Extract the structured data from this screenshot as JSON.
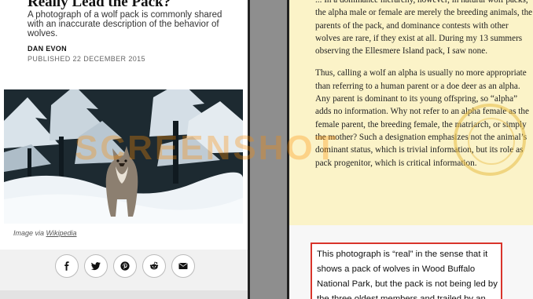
{
  "left_article": {
    "headline_tail": "Really Lead the Pack?",
    "summary": "A photograph of a wolf pack is commonly shared with an inaccurate description of the behavior of wolves.",
    "author": "DAN EVON",
    "published": "PUBLISHED 22 DECEMBER 2015",
    "caption_prefix": "Image via",
    "caption_link": "Wikipedia",
    "share_icons": [
      "facebook-icon",
      "twitter-icon",
      "pinterest-icon",
      "reddit-icon",
      "email-icon"
    ]
  },
  "right_book": {
    "paragraph_1": "... In a dominance hierarchy, however, in natural wolf packs, the alpha male or female are merely the breeding animals, the parents of the pack, and dominance contests with other wolves are rare, if they exist at all. During my 13 summers observing the Ellesmere Island pack, I saw none.",
    "paragraph_2": "Thus, calling a wolf an alpha is usually no more appropriate than referring to a human parent or a doe deer as an alpha. Any parent is dominant to its young offspring, so “alpha” adds no information. Why not refer to an alpha female as the female parent, the breeding female, the matriarch, or simply the mother? Such a designation emphasizes not the animal’s dominant status, which is trivial information, but its role as pack progenitor, which is critical information."
  },
  "highlight": {
    "text": "This photograph is “real” in the sense that it shows a pack of wolves in Wood Buffalo National Park, but the pack is not being led by the three oldest members and trailed by an"
  },
  "watermark": "SCREENSHOT",
  "colors": {
    "highlight_border": "#d9342b",
    "book_background": "#fbf3c8"
  }
}
